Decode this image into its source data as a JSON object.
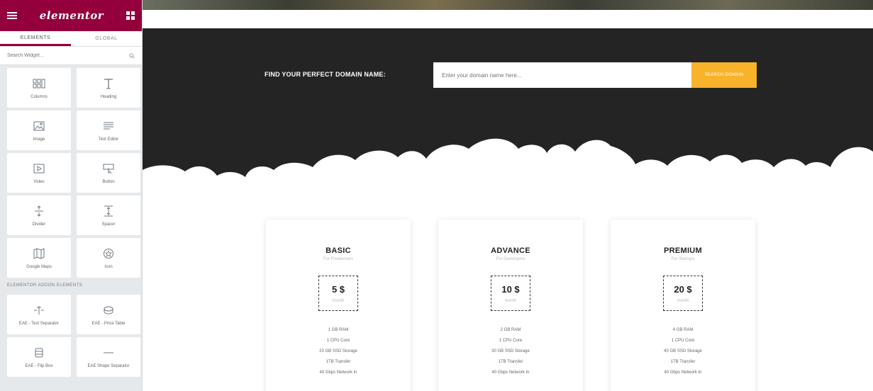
{
  "sidebar": {
    "logo": "elementor",
    "tabs": [
      {
        "label": "ELEMENTS"
      },
      {
        "label": "GLOBAL"
      }
    ],
    "search_placeholder": "Search Widget...",
    "widgets": [
      {
        "label": "Columns",
        "icon": "columns-icon"
      },
      {
        "label": "Heading",
        "icon": "heading-icon"
      },
      {
        "label": "Image",
        "icon": "image-icon"
      },
      {
        "label": "Text Editor",
        "icon": "text-editor-icon"
      },
      {
        "label": "Video",
        "icon": "video-icon"
      },
      {
        "label": "Button",
        "icon": "button-icon"
      },
      {
        "label": "Divider",
        "icon": "divider-icon"
      },
      {
        "label": "Spacer",
        "icon": "spacer-icon"
      },
      {
        "label": "Google Maps",
        "icon": "map-icon"
      },
      {
        "label": "Icon",
        "icon": "star-icon"
      }
    ],
    "addon_section_label": "ELEMENTOR ADDON ELEMENTS",
    "addon_widgets": [
      {
        "label": "EAE - Text Separator",
        "icon": "text-separator-icon"
      },
      {
        "label": "EAE - Price Table",
        "icon": "price-table-icon"
      },
      {
        "label": "EAE - Flip Box",
        "icon": "flip-box-icon"
      },
      {
        "label": "EAE Shape Separator",
        "icon": "shape-separator-icon"
      }
    ]
  },
  "hero": {
    "label": "FIND YOUR PERFECT DOMAIN NAME:",
    "input_placeholder": "Enter your domain name here...",
    "button_label": "SEARCH DOMAIN",
    "accent_color": "#f8b32b",
    "background_color": "#242424"
  },
  "plans": [
    {
      "name": "BASIC",
      "audience": "For Freelancers",
      "price": "5 $",
      "period": "month",
      "features": [
        "1 GB RAM",
        "1 CPU Core",
        "20 GB SSD Storage",
        "1TB Transfer",
        "40 Gbps Network In"
      ]
    },
    {
      "name": "ADVANCE",
      "audience": "For Developers",
      "price": "10 $",
      "period": "month",
      "features": [
        "2 GB RAM",
        "1 CPU Core",
        "30 GB SSD Storage",
        "1TB Transfer",
        "40 Gbps Network In"
      ]
    },
    {
      "name": "PREMIUM",
      "audience": "For Startups",
      "price": "20 $",
      "period": "month",
      "features": [
        "4 GB RAM",
        "1 CPU Core",
        "40 GB SSD Storage",
        "1TB Transfer",
        "40 Gbps Network In"
      ]
    }
  ],
  "brand_color": "#93003c"
}
